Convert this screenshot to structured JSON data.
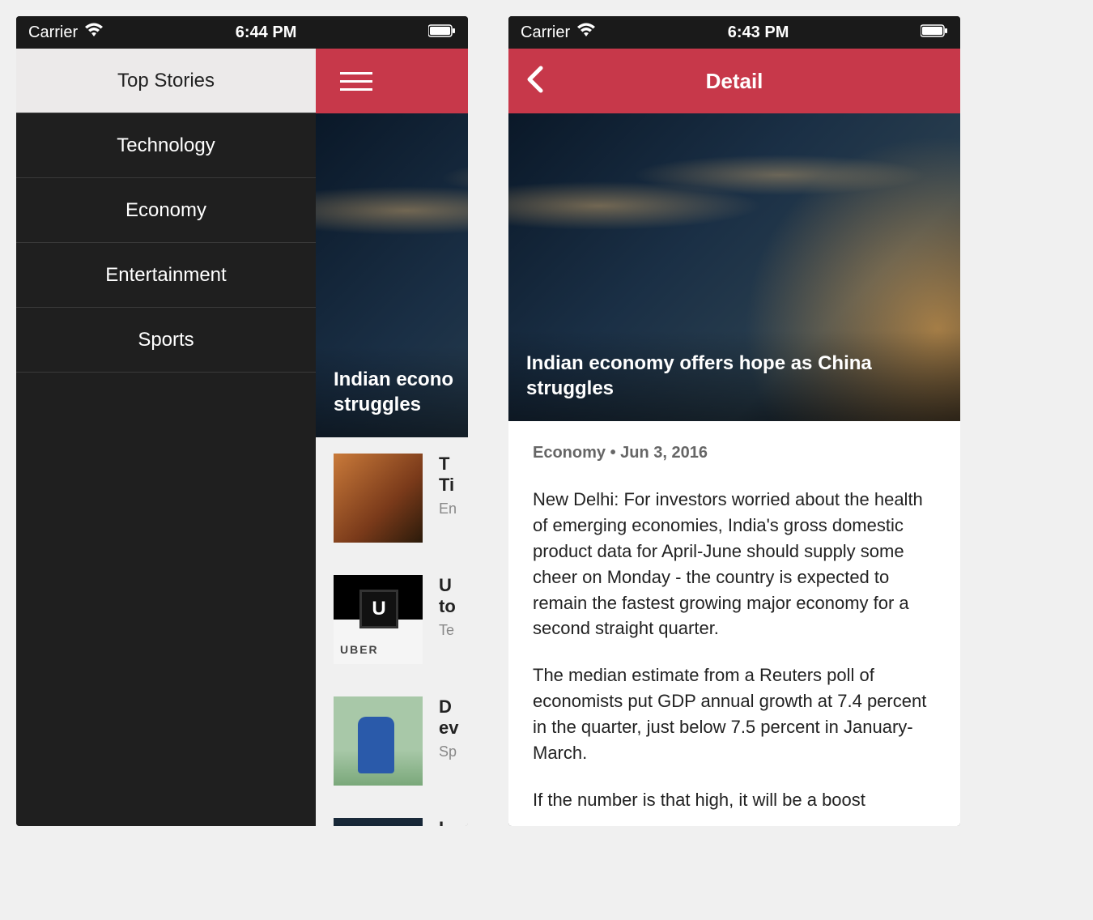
{
  "status": {
    "carrier": "Carrier",
    "time_left": "6:44 PM",
    "time_right": "6:43 PM"
  },
  "drawer": {
    "items": [
      {
        "label": "Top Stories",
        "active": true
      },
      {
        "label": "Technology",
        "active": false
      },
      {
        "label": "Economy",
        "active": false
      },
      {
        "label": "Entertainment",
        "active": false
      },
      {
        "label": "Sports",
        "active": false
      }
    ]
  },
  "hero": {
    "headline_partial": "Indian econo\nstruggles",
    "headline_full": "Indian economy offers hope as China struggles"
  },
  "articles": [
    {
      "title_partial": "T\nTi",
      "category_partial": "En"
    },
    {
      "title_partial": "U\nto",
      "category_partial": "Te"
    },
    {
      "title_partial": "D\nev",
      "category_partial": "Sp"
    },
    {
      "title_partial": "I",
      "category_partial": ""
    }
  ],
  "detail": {
    "nav_title": "Detail",
    "category": "Economy",
    "date": "Jun 3, 2016",
    "meta_sep": "  •  ",
    "p1": "New Delhi: For investors worried about the health of emerging economies, India's gross domestic product data for April-June should supply some cheer on Monday - the country is expected to remain the fastest growing major economy for a second straight quarter.",
    "p2": "The median estimate from a Reuters poll of economists put GDP annual growth at 7.4 percent in the quarter, just below 7.5 percent in January-March.",
    "p3": "If the number is that high, it will be a boost"
  }
}
